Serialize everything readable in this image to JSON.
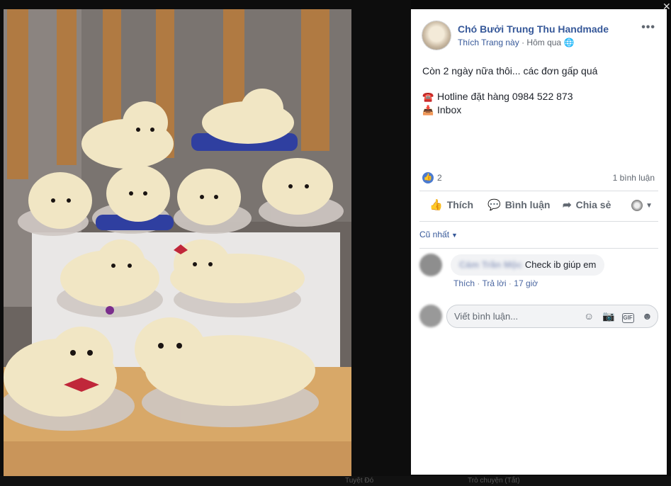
{
  "header": {
    "page_name": "Chó Bưởi Trung Thu Handmade",
    "like_page": "Thích Trang này",
    "separator": "·",
    "time": "Hôm qua",
    "more": "•••"
  },
  "post": {
    "line1": "Còn 2 ngày nữa thôi... các đơn gấp quá",
    "hotline_emoji": "☎️",
    "hotline": "Hotline đặt hàng 0984 522 873",
    "inbox_emoji": "📥",
    "inbox": "Inbox"
  },
  "reactions": {
    "like_count": "2",
    "comment_count": "1 bình luận"
  },
  "actions": {
    "like": "Thích",
    "comment": "Bình luận",
    "share": "Chia sẻ"
  },
  "comments": {
    "sort_label": "Cũ nhất",
    "items": [
      {
        "author": "Cám Trần Mộc",
        "text": "Check ib giúp em",
        "like": "Thích",
        "reply": "Trả lời",
        "time": "17 giờ",
        "sep": "·"
      }
    ],
    "write_placeholder": "Viết bình luận..."
  },
  "bottom_bar": {
    "left_text": "Tuyệt Đó",
    "right_text": "Trò chuyện (Tắt)"
  },
  "icons": {
    "globe": "globe-icon",
    "like": "thumbs-up-icon",
    "comment": "speech-bubble-icon",
    "share": "share-arrow-icon",
    "emoji": "smiley-icon",
    "camera": "camera-icon",
    "gif": "gif-icon",
    "sticker": "sticker-icon",
    "close": "close-icon"
  },
  "colors": {
    "link": "#365899",
    "like_blue": "#4b7bd0",
    "text": "#1d2129",
    "muted": "#606770"
  }
}
